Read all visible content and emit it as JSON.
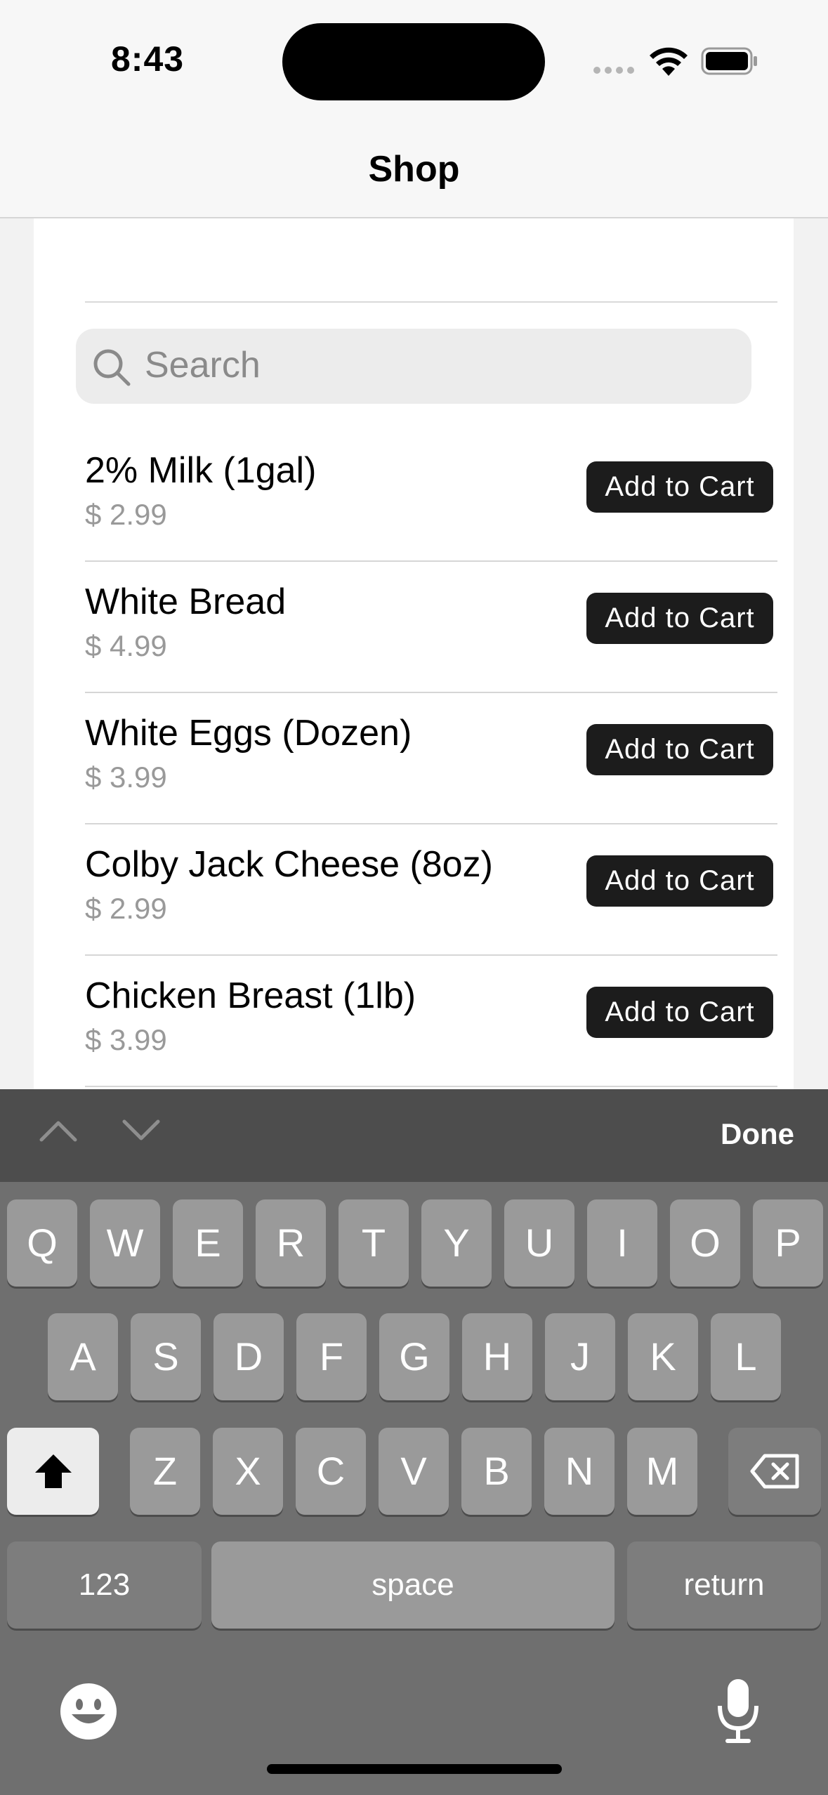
{
  "status_bar": {
    "time": "8:43"
  },
  "nav": {
    "title": "Shop"
  },
  "search": {
    "placeholder": "Search"
  },
  "products": [
    {
      "name": "2% Milk (1gal)",
      "price": "$ 2.99",
      "button": "Add to Cart"
    },
    {
      "name": "White Bread",
      "price": "$ 4.99",
      "button": "Add to Cart"
    },
    {
      "name": "White Eggs (Dozen)",
      "price": "$ 3.99",
      "button": "Add to Cart"
    },
    {
      "name": "Colby Jack Cheese (8oz)",
      "price": "$ 2.99",
      "button": "Add to Cart"
    },
    {
      "name": "Chicken Breast (1lb)",
      "price": "$ 3.99",
      "button": "Add to Cart"
    }
  ],
  "keyboard": {
    "accessory": {
      "done_label": "Done"
    },
    "row1": [
      "Q",
      "W",
      "E",
      "R",
      "T",
      "Y",
      "U",
      "I",
      "O",
      "P"
    ],
    "row2": [
      "A",
      "S",
      "D",
      "F",
      "G",
      "H",
      "J",
      "K",
      "L"
    ],
    "row3": [
      "Z",
      "X",
      "C",
      "V",
      "B",
      "N",
      "M"
    ],
    "numbers_label": "123",
    "space_label": "space",
    "return_label": "return"
  },
  "icons": {
    "search": "search-icon",
    "wifi": "wifi-icon",
    "battery": "battery-icon",
    "shift": "shift-icon",
    "delete": "delete-icon",
    "emoji": "emoji-icon",
    "mic": "microphone-icon",
    "prev": "chevron-up-icon",
    "next": "chevron-down-icon"
  }
}
